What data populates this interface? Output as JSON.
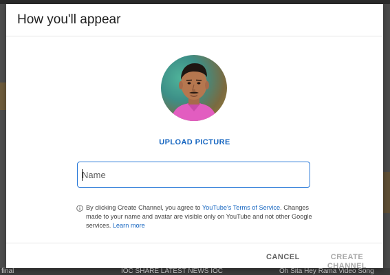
{
  "background": {
    "bottom_texts": [
      "final",
      "IOC SHARE LATEST NEWS IOC",
      "Oh Sita Hey Rama Video Song"
    ]
  },
  "dialog": {
    "title": "How you'll appear",
    "avatar_icon": "profile-photo",
    "upload_label": "UPLOAD PICTURE",
    "name_input": {
      "value": "",
      "placeholder": "Name"
    },
    "notice": {
      "icon": "info-icon",
      "text_before": "By clicking Create Channel, you agree to ",
      "terms_link": "YouTube's Terms of Service",
      "text_after": ". Changes made to your name and avatar are visible only on YouTube and not other Google services. ",
      "learn_more_link": "Learn more"
    },
    "buttons": {
      "cancel": "CANCEL",
      "create": "CREATE CHANNEL"
    }
  },
  "colors": {
    "accent": "#1565c0",
    "focus_border": "#2979d8",
    "disabled_text": "#a8a8a8"
  }
}
